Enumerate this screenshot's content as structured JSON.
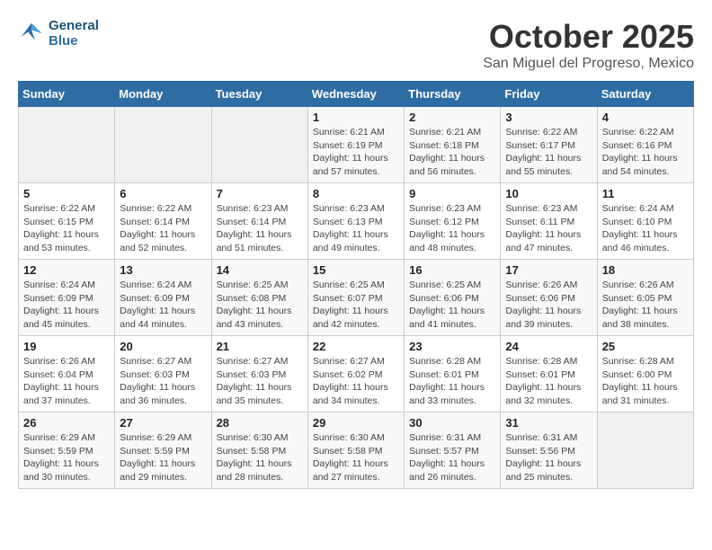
{
  "logo": {
    "line1": "General",
    "line2": "Blue"
  },
  "title": "October 2025",
  "location": "San Miguel del Progreso, Mexico",
  "weekdays": [
    "Sunday",
    "Monday",
    "Tuesday",
    "Wednesday",
    "Thursday",
    "Friday",
    "Saturday"
  ],
  "weeks": [
    [
      {
        "day": "",
        "info": ""
      },
      {
        "day": "",
        "info": ""
      },
      {
        "day": "",
        "info": ""
      },
      {
        "day": "1",
        "info": "Sunrise: 6:21 AM\nSunset: 6:19 PM\nDaylight: 11 hours\nand 57 minutes."
      },
      {
        "day": "2",
        "info": "Sunrise: 6:21 AM\nSunset: 6:18 PM\nDaylight: 11 hours\nand 56 minutes."
      },
      {
        "day": "3",
        "info": "Sunrise: 6:22 AM\nSunset: 6:17 PM\nDaylight: 11 hours\nand 55 minutes."
      },
      {
        "day": "4",
        "info": "Sunrise: 6:22 AM\nSunset: 6:16 PM\nDaylight: 11 hours\nand 54 minutes."
      }
    ],
    [
      {
        "day": "5",
        "info": "Sunrise: 6:22 AM\nSunset: 6:15 PM\nDaylight: 11 hours\nand 53 minutes."
      },
      {
        "day": "6",
        "info": "Sunrise: 6:22 AM\nSunset: 6:14 PM\nDaylight: 11 hours\nand 52 minutes."
      },
      {
        "day": "7",
        "info": "Sunrise: 6:23 AM\nSunset: 6:14 PM\nDaylight: 11 hours\nand 51 minutes."
      },
      {
        "day": "8",
        "info": "Sunrise: 6:23 AM\nSunset: 6:13 PM\nDaylight: 11 hours\nand 49 minutes."
      },
      {
        "day": "9",
        "info": "Sunrise: 6:23 AM\nSunset: 6:12 PM\nDaylight: 11 hours\nand 48 minutes."
      },
      {
        "day": "10",
        "info": "Sunrise: 6:23 AM\nSunset: 6:11 PM\nDaylight: 11 hours\nand 47 minutes."
      },
      {
        "day": "11",
        "info": "Sunrise: 6:24 AM\nSunset: 6:10 PM\nDaylight: 11 hours\nand 46 minutes."
      }
    ],
    [
      {
        "day": "12",
        "info": "Sunrise: 6:24 AM\nSunset: 6:09 PM\nDaylight: 11 hours\nand 45 minutes."
      },
      {
        "day": "13",
        "info": "Sunrise: 6:24 AM\nSunset: 6:09 PM\nDaylight: 11 hours\nand 44 minutes."
      },
      {
        "day": "14",
        "info": "Sunrise: 6:25 AM\nSunset: 6:08 PM\nDaylight: 11 hours\nand 43 minutes."
      },
      {
        "day": "15",
        "info": "Sunrise: 6:25 AM\nSunset: 6:07 PM\nDaylight: 11 hours\nand 42 minutes."
      },
      {
        "day": "16",
        "info": "Sunrise: 6:25 AM\nSunset: 6:06 PM\nDaylight: 11 hours\nand 41 minutes."
      },
      {
        "day": "17",
        "info": "Sunrise: 6:26 AM\nSunset: 6:06 PM\nDaylight: 11 hours\nand 39 minutes."
      },
      {
        "day": "18",
        "info": "Sunrise: 6:26 AM\nSunset: 6:05 PM\nDaylight: 11 hours\nand 38 minutes."
      }
    ],
    [
      {
        "day": "19",
        "info": "Sunrise: 6:26 AM\nSunset: 6:04 PM\nDaylight: 11 hours\nand 37 minutes."
      },
      {
        "day": "20",
        "info": "Sunrise: 6:27 AM\nSunset: 6:03 PM\nDaylight: 11 hours\nand 36 minutes."
      },
      {
        "day": "21",
        "info": "Sunrise: 6:27 AM\nSunset: 6:03 PM\nDaylight: 11 hours\nand 35 minutes."
      },
      {
        "day": "22",
        "info": "Sunrise: 6:27 AM\nSunset: 6:02 PM\nDaylight: 11 hours\nand 34 minutes."
      },
      {
        "day": "23",
        "info": "Sunrise: 6:28 AM\nSunset: 6:01 PM\nDaylight: 11 hours\nand 33 minutes."
      },
      {
        "day": "24",
        "info": "Sunrise: 6:28 AM\nSunset: 6:01 PM\nDaylight: 11 hours\nand 32 minutes."
      },
      {
        "day": "25",
        "info": "Sunrise: 6:28 AM\nSunset: 6:00 PM\nDaylight: 11 hours\nand 31 minutes."
      }
    ],
    [
      {
        "day": "26",
        "info": "Sunrise: 6:29 AM\nSunset: 5:59 PM\nDaylight: 11 hours\nand 30 minutes."
      },
      {
        "day": "27",
        "info": "Sunrise: 6:29 AM\nSunset: 5:59 PM\nDaylight: 11 hours\nand 29 minutes."
      },
      {
        "day": "28",
        "info": "Sunrise: 6:30 AM\nSunset: 5:58 PM\nDaylight: 11 hours\nand 28 minutes."
      },
      {
        "day": "29",
        "info": "Sunrise: 6:30 AM\nSunset: 5:58 PM\nDaylight: 11 hours\nand 27 minutes."
      },
      {
        "day": "30",
        "info": "Sunrise: 6:31 AM\nSunset: 5:57 PM\nDaylight: 11 hours\nand 26 minutes."
      },
      {
        "day": "31",
        "info": "Sunrise: 6:31 AM\nSunset: 5:56 PM\nDaylight: 11 hours\nand 25 minutes."
      },
      {
        "day": "",
        "info": ""
      }
    ]
  ]
}
